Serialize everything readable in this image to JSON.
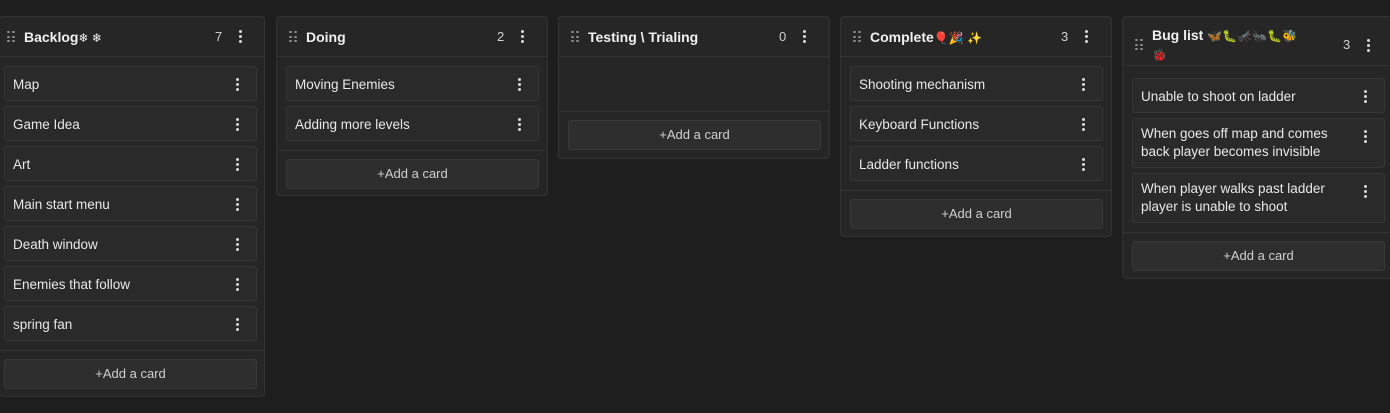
{
  "colors": {
    "background": "#1e1e1e",
    "column": "#262626",
    "card": "#2a2a2a",
    "text": "#e8e8e8"
  },
  "columns": [
    {
      "title": "Backlog",
      "title_emoji": "❄ ❄",
      "count": "7",
      "cards": [
        "Map",
        "Game Idea",
        "Art",
        "Main start menu",
        "Death window",
        "Enemies that follow",
        "spring fan"
      ],
      "add_label": "+Add a card"
    },
    {
      "title": "Doing",
      "title_emoji": "",
      "count": "2",
      "cards": [
        "Moving Enemies",
        "Adding more levels"
      ],
      "add_label": "+Add a card"
    },
    {
      "title": "Testing \\ Trialing",
      "title_emoji": "",
      "count": "0",
      "cards": [],
      "add_label": "+Add a card"
    },
    {
      "title": "Complete",
      "title_emoji": "🎈🎉 ✨",
      "count": "3",
      "cards": [
        "Shooting mechanism",
        "Keyboard Functions",
        "Ladder functions"
      ],
      "add_label": "+Add a card"
    },
    {
      "title": "Bug list",
      "title_emoji": "🦋🐛🦟🐜🐛🐝",
      "title_emoji_line2": "🐞",
      "count": "3",
      "cards": [
        "Unable to shoot on ladder",
        [
          "When goes off map and comes",
          "back player becomes invisible"
        ],
        [
          "When player walks past ladder",
          "player is unable to shoot"
        ]
      ],
      "add_label": "+Add a card"
    }
  ]
}
